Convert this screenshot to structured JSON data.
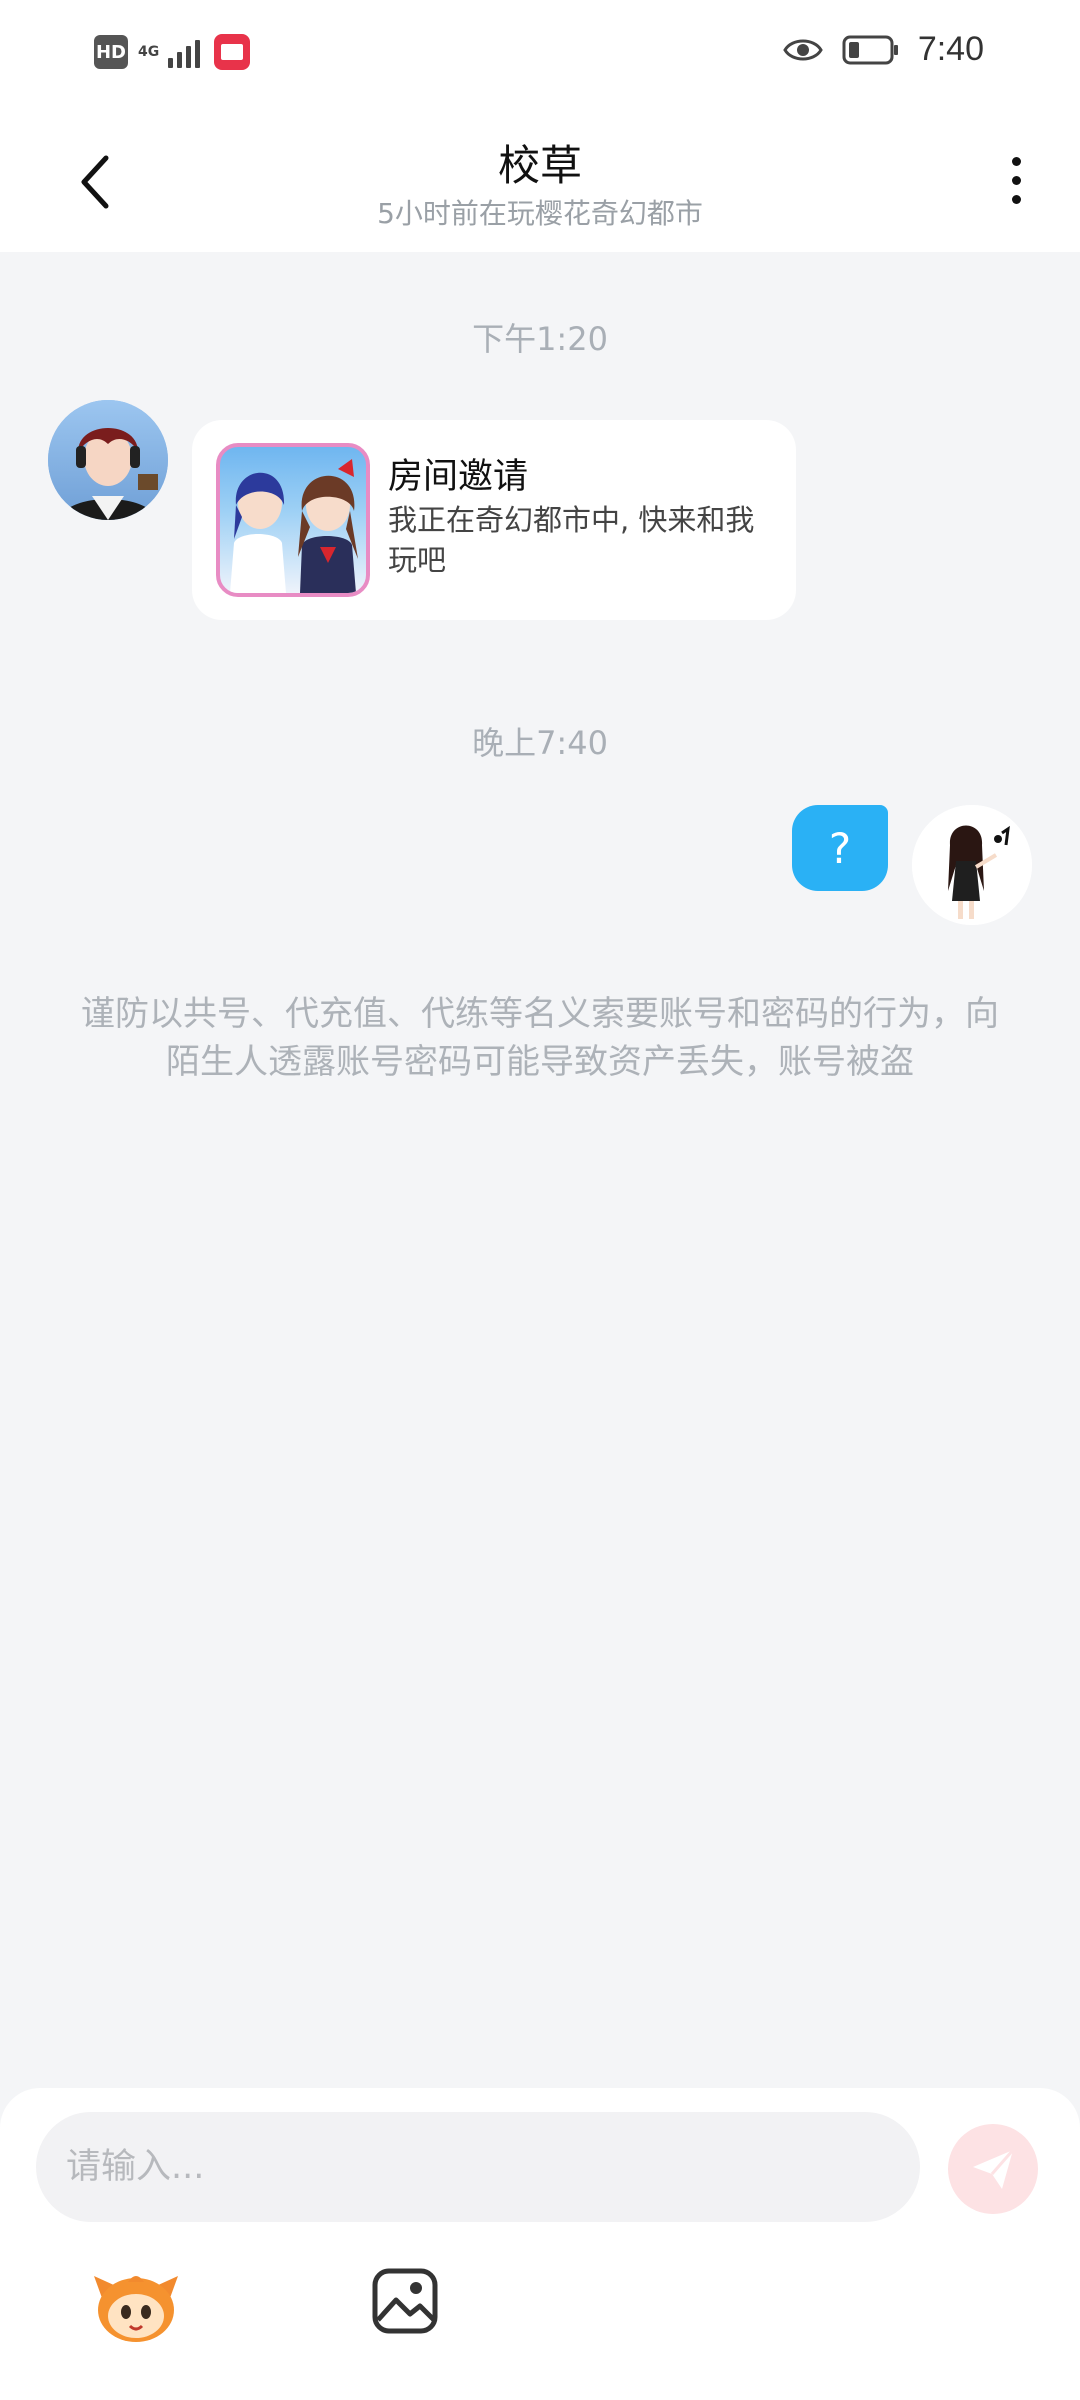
{
  "status_bar": {
    "hd": "HD",
    "network": "4G",
    "time": "7:40",
    "icons": [
      "hd-icon",
      "4g-signal-icon",
      "book-app-icon",
      "eye-icon",
      "battery-icon"
    ]
  },
  "header": {
    "title": "校草",
    "subtitle": "5小时前在玩樱花奇幻都市",
    "icons": [
      "back-arrow-icon",
      "more-vertical-icon"
    ]
  },
  "messages": {
    "time_1": "下午1:20",
    "invite": {
      "title": "房间邀请",
      "description": "我正在奇幻都市中, 快来和我玩吧"
    },
    "time_2": "晚上7:40",
    "sent_text": "?",
    "warning": "谨防以共号、代充值、代练等名义索要账号和密码的行为，向陌生人透露账号密码可能导致资产丢失，账号被盗"
  },
  "input": {
    "placeholder": "请输入..."
  },
  "colors": {
    "accent_blue": "#2ab1f5",
    "send_pink": "#fde2e4",
    "background": "#f4f5f7",
    "thumb_border": "#e88cc4"
  },
  "toolbar_icons": [
    "emoji-mascot-icon",
    "image-icon",
    "send-icon"
  ]
}
